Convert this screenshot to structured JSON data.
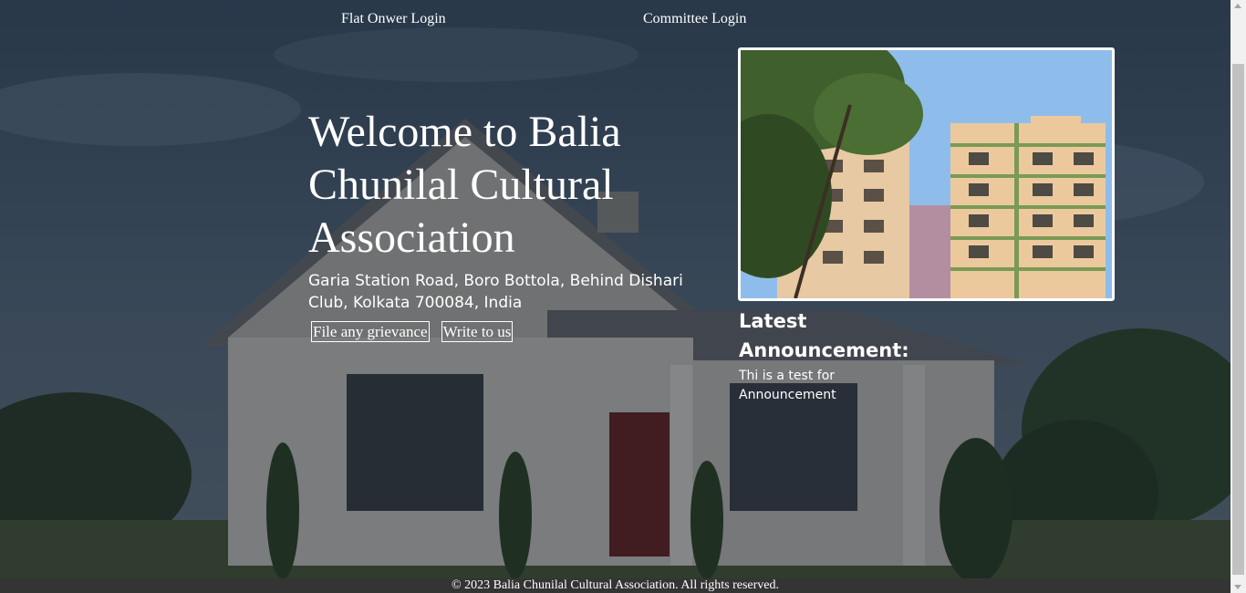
{
  "nav": {
    "flat_owner_login": "Flat Onwer Login",
    "committee_login": "Committee Login"
  },
  "hero": {
    "title": "Welcome to Balia Chunilal Cultural Association",
    "address": "Garia Station Road, Boro Bottola, Behind Dishari Club, Kolkata 700084, India",
    "grievance_button": "File any grievance",
    "write_button": "Write to us"
  },
  "announcement": {
    "heading": "Latest Announcement:",
    "text": "Thi is a test for Announcement"
  },
  "footer": {
    "text": "© 2023 Balia Chunilal Cultural Association. All rights reserved."
  },
  "colors": {
    "footer_bg": "#343434",
    "overlay": "rgba(10,18,30,0.42)",
    "text": "#ffffff"
  }
}
